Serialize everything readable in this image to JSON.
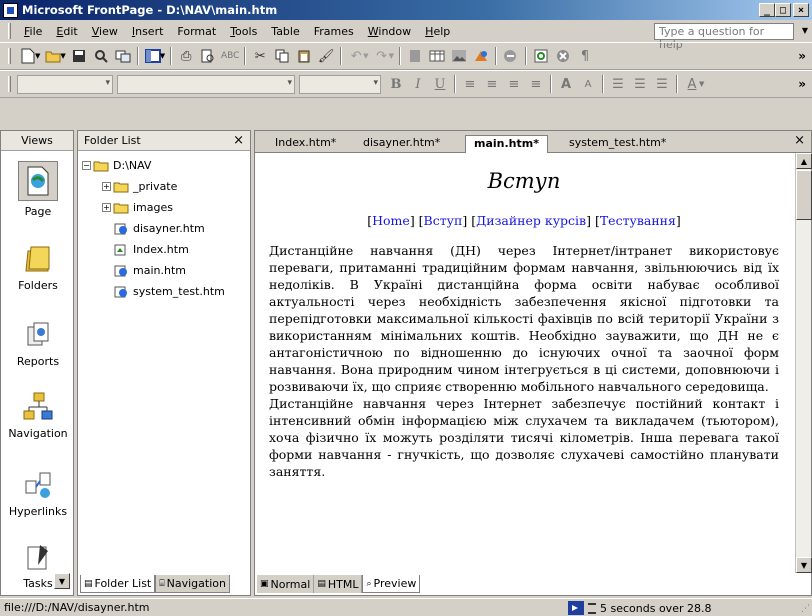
{
  "window": {
    "title": "Microsoft FrontPage - D:\\NAV\\main.htm"
  },
  "menubar": {
    "items": [
      {
        "key": "F",
        "rest": "ile"
      },
      {
        "key": "E",
        "rest": "dit"
      },
      {
        "key": "V",
        "rest": "iew"
      },
      {
        "key": "I",
        "rest": "nsert"
      },
      {
        "key": "",
        "rest": "Format"
      },
      {
        "key": "T",
        "rest": "ools"
      },
      {
        "key": "",
        "rest": "Table"
      },
      {
        "key": "",
        "rest": "Frames"
      },
      {
        "key": "W",
        "rest": "indow"
      },
      {
        "key": "H",
        "rest": "elp"
      }
    ],
    "help_placeholder": "Type a question for help"
  },
  "format_toolbar": {
    "bold": "B",
    "italic": "I",
    "underline": "U"
  },
  "views": {
    "header": "Views",
    "items": [
      "Page",
      "Folders",
      "Reports",
      "Navigation",
      "Hyperlinks",
      "Tasks"
    ]
  },
  "folder_list": {
    "header": "Folder List",
    "root": "D:\\NAV",
    "items": [
      "_private",
      "images",
      "disayner.htm",
      "Index.htm",
      "main.htm",
      "system_test.htm"
    ],
    "tabs": [
      "Folder List",
      "Navigation"
    ]
  },
  "editor": {
    "tabs": [
      "Index.htm*",
      "disayner.htm*",
      "main.htm*",
      "system_test.htm*"
    ],
    "active_tab": "main.htm*",
    "mode_tabs": [
      "Normal",
      "HTML",
      "Preview"
    ],
    "active_mode": "Preview"
  },
  "document": {
    "heading": "Вступ",
    "links": [
      "Home",
      "Вступ",
      "Дизайнер курсів",
      "Тестування"
    ],
    "paragraph1": "Дистанційне навчання (ДН) через Інтернет/інтранет використовує переваги, притаманні традиційним формам навчання, звільнюючись від їх недоліків. В Україні дистанційна форма освіти набуває особливої актуальності через необхідність забезпечення якісної підготовки та перепідготовки максимальної кількості фахівців по всій території України з використанням мінімальних коштів. Необхідно зауважити, що ДН не є антагоністичною по відношенню до існуючих очної та заочної форм навчання. Вона природним чином інтегрується в ці системи, доповнюючи і розвиваючи їх, що сприяє створенню мобільного навчального середовища.",
    "paragraph2": "Дистанційне навчання через Інтернет забезпечує постійний контакт і інтенсивний обмін інформацією між слухачем та викладачем (тьютором), хоча фізично їх можуть розділяти тисячі кілометрів. Інша перевага такої форми навчання - гнучкість, що дозволяє слухачеві самостійно планувати заняття."
  },
  "statusbar": {
    "path": "file:///D:/NAV/disayner.htm",
    "timing": "5 seconds over 28.8"
  }
}
